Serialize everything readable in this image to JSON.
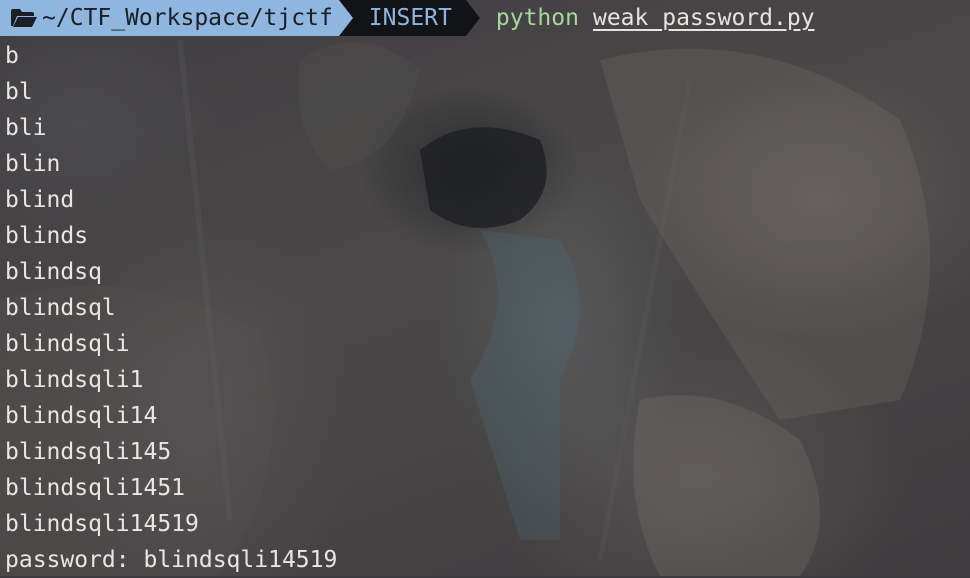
{
  "prompt": {
    "path": "~/CTF_Workspace/tjctf",
    "mode": "INSERT",
    "command": "python",
    "argument": "weak_password.py",
    "folder_icon": "folder-open-icon",
    "colors": {
      "path_bg": "#8fb6de",
      "mode_bg": "#111317",
      "mode_fg": "#8fb6de",
      "command_fg": "#a6d79b",
      "text_fg": "#e8e6e3"
    }
  },
  "output": [
    "b",
    "bl",
    "bli",
    "blin",
    "blind",
    "blinds",
    "blindsq",
    "blindsql",
    "blindsqli",
    "blindsqli1",
    "blindsqli14",
    "blindsqli145",
    "blindsqli1451",
    "blindsqli14519",
    "password: blindsqli14519"
  ]
}
